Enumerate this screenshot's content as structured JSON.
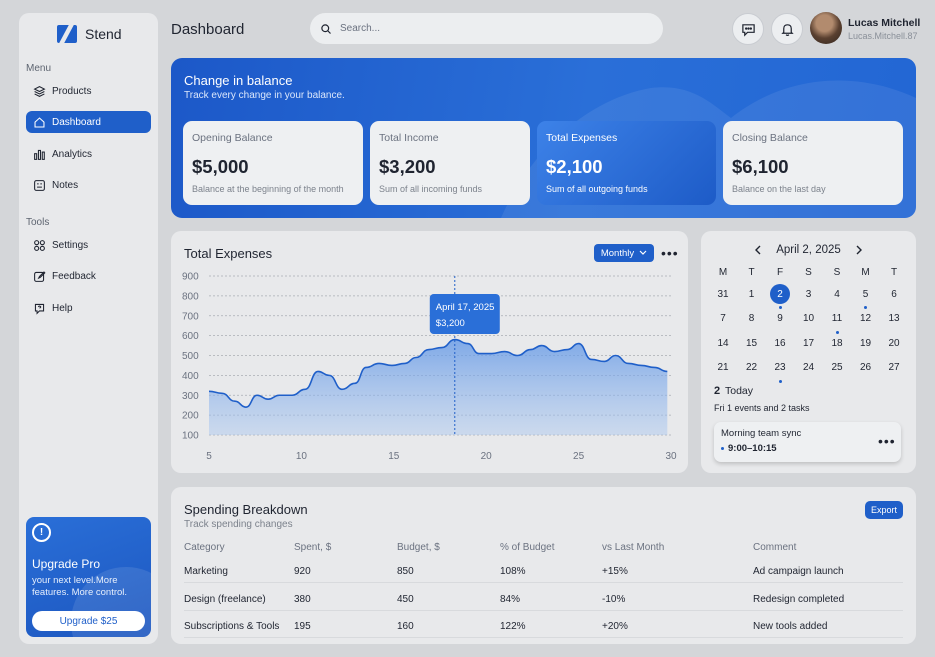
{
  "brand": {
    "name": "Stend"
  },
  "header": {
    "title": "Dashboard",
    "search_placeholder": "Search..."
  },
  "user": {
    "name": "Lucas Mitchell",
    "handle": "Lucas.Mitchell.87"
  },
  "sidebar": {
    "menu_label": "Menu",
    "tools_label": "Tools",
    "menu_items": [
      {
        "label": "Products",
        "icon": "layers-icon"
      },
      {
        "label": "Dashboard",
        "icon": "home-icon",
        "active": true
      },
      {
        "label": "Analytics",
        "icon": "bar-chart-icon"
      },
      {
        "label": "Notes",
        "icon": "notes-icon"
      }
    ],
    "tool_items": [
      {
        "label": "Settings",
        "icon": "grid-icon"
      },
      {
        "label": "Feedback",
        "icon": "edit-icon"
      },
      {
        "label": "Help",
        "icon": "help-icon"
      }
    ],
    "upgrade": {
      "title": "Upgrade Pro",
      "text": "your next level.More features. More control.",
      "button": "Upgrade $25",
      "icon": "info-icon"
    }
  },
  "balance": {
    "title": "Change in balance",
    "subtitle": "Track every change in your balance.",
    "cards": [
      {
        "label": "Opening Balance",
        "value": "$5,000",
        "desc": "Balance at the beginning of the month"
      },
      {
        "label": "Total Income",
        "value": "$3,200",
        "desc": "Sum of all incoming funds"
      },
      {
        "label": "Total Expenses",
        "value": "$2,100",
        "desc": "Sum of all outgoing funds",
        "highlighted": true
      },
      {
        "label": "Closing Balance",
        "value": "$6,100",
        "desc": "Balance on the last day"
      }
    ]
  },
  "expenses": {
    "title": "Total Expenses",
    "period": "Monthly",
    "tooltip": {
      "date": "April 17, 2025",
      "value": "$3,200"
    }
  },
  "chart_data": {
    "type": "area",
    "title": "Total Expenses",
    "xlabel": "",
    "ylabel": "",
    "xlim": [
      5,
      30
    ],
    "ylim": [
      100,
      900
    ],
    "x_ticks": [
      5,
      10,
      15,
      20,
      25,
      30
    ],
    "y_ticks": [
      100,
      200,
      300,
      400,
      500,
      600,
      700,
      800,
      900
    ],
    "grid": true,
    "color": "#1f5fc9",
    "x": [
      5,
      5.7,
      6.4,
      7,
      7.6,
      8.2,
      8.8,
      9.5,
      10.2,
      10.9,
      11.5,
      12.2,
      12.9,
      13.5,
      14.2,
      14.9,
      15.6,
      16.2,
      16.9,
      17.6,
      18.3,
      19,
      19.6,
      20.3,
      21,
      21.7,
      22.4,
      23,
      23.7,
      24.4,
      25,
      25.7,
      26.4,
      27,
      27.7,
      28.4,
      29.1,
      29.8
    ],
    "y": [
      320,
      310,
      270,
      240,
      300,
      280,
      300,
      300,
      330,
      420,
      400,
      330,
      360,
      440,
      460,
      450,
      460,
      490,
      530,
      540,
      580,
      560,
      510,
      510,
      520,
      500,
      530,
      550,
      520,
      530,
      560,
      480,
      470,
      500,
      460,
      450,
      440,
      420
    ],
    "highlight": {
      "x": 18.3,
      "y": 580
    }
  },
  "calendar": {
    "month_label": "April 2, 2025",
    "weekdays": [
      "M",
      "T",
      "F",
      "S",
      "S",
      "M",
      "T"
    ],
    "weeks": [
      [
        "31",
        "1",
        "2",
        "3",
        "4",
        "5",
        "6"
      ],
      [
        "7",
        "8",
        "9",
        "10",
        "11",
        "12",
        "13"
      ],
      [
        "14",
        "15",
        "16",
        "17",
        "18",
        "19",
        "20"
      ],
      [
        "21",
        "22",
        "23",
        "24",
        "25",
        "26",
        "27"
      ]
    ],
    "selected_day": "2",
    "dotted_days": [
      "2",
      "5",
      "11",
      "23"
    ],
    "today_number": "2",
    "today_label": "Today",
    "today_summary": "Fri  1 events and 2 tasks",
    "event": {
      "title": "Morning team sync",
      "time": "9:00–10:15"
    }
  },
  "spending": {
    "title": "Spending Breakdown",
    "subtitle": "Track spending changes",
    "export_label": "Export",
    "columns": [
      "Category",
      "Spent, $",
      "Budget, $",
      "% of Budget",
      "vs Last Month",
      "Comment"
    ],
    "rows": [
      [
        "Marketing",
        "920",
        "850",
        "108%",
        "+15%",
        "Ad campaign launch"
      ],
      [
        "Design (freelance)",
        "380",
        "450",
        "84%",
        "-10%",
        "Redesign completed"
      ],
      [
        "Subscriptions & Tools",
        "195",
        "160",
        "122%",
        "+20%",
        "New tools added"
      ]
    ]
  }
}
